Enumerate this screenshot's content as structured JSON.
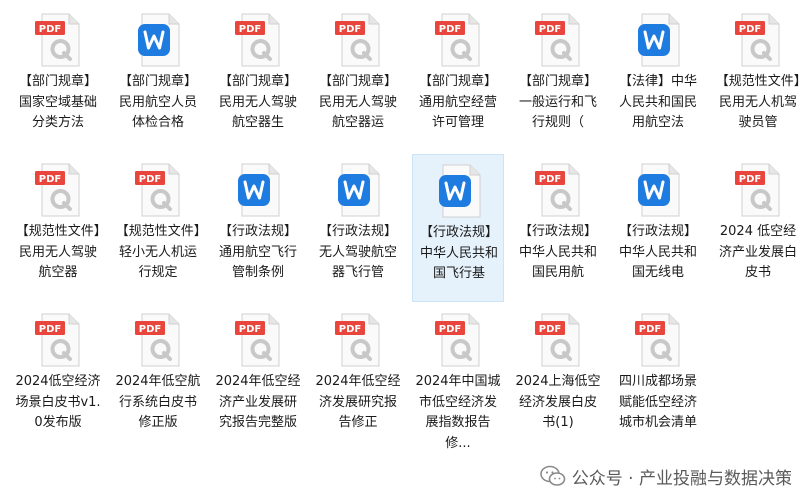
{
  "files": [
    {
      "type": "pdf",
      "name": "【部门规章】国家空域基础分类方法"
    },
    {
      "type": "word",
      "name": "【部门规章】民用航空人员体检合格"
    },
    {
      "type": "pdf",
      "name": "【部门规章】民用无人驾驶航空器生"
    },
    {
      "type": "pdf",
      "name": "【部门规章】民用无人驾驶航空器运"
    },
    {
      "type": "pdf",
      "name": "【部门规章】通用航空经营许可管理"
    },
    {
      "type": "pdf",
      "name": "【部门规章】一般运行和飞行规则（"
    },
    {
      "type": "word",
      "name": "【法律】中华人民共和国民用航空法"
    },
    {
      "type": "pdf",
      "name": "【规范性文件】民用无人机驾驶员管"
    },
    {
      "type": "pdf",
      "name": "【规范性文件】民用无人驾驶航空器"
    },
    {
      "type": "pdf",
      "name": "【规范性文件】轻小无人机运行规定"
    },
    {
      "type": "word",
      "name": "【行政法规】通用航空飞行管制条例"
    },
    {
      "type": "word",
      "name": "【行政法规】无人驾驶航空器飞行管"
    },
    {
      "type": "word",
      "name": "【行政法规】中华人民共和国飞行基",
      "selected": true
    },
    {
      "type": "pdf",
      "name": "【行政法规】中华人民共和国民用航"
    },
    {
      "type": "word",
      "name": "【行政法规】中华人民共和国无线电"
    },
    {
      "type": "pdf",
      "name": "2024 低空经济产业发展白皮书"
    },
    {
      "type": "pdf",
      "name": "2024低空经济场景白皮书v1.0发布版"
    },
    {
      "type": "pdf",
      "name": "2024年低空航行系统白皮书修正版"
    },
    {
      "type": "pdf",
      "name": "2024年低空经济产业发展研究报告完整版"
    },
    {
      "type": "pdf",
      "name": "2024年低空经济发展研究报告修正"
    },
    {
      "type": "pdf",
      "name": "2024年中国城市低空经济发展指数报告修..."
    },
    {
      "type": "pdf",
      "name": "2024上海低空经济发展白皮书(1)"
    },
    {
      "type": "pdf",
      "name": "四川成都场景赋能低空经济城市机会清单"
    }
  ],
  "icons": {
    "pdf": "pdf-file-icon",
    "word": "word-file-icon",
    "watermark": "wechat-icon"
  },
  "colors": {
    "pdf_badge": "#e8463c",
    "pdf_q": "#c8c8c8",
    "word_blue": "#1e7be0",
    "selected_bg": "#e5f1fb"
  },
  "watermark": {
    "text": "公众号 · 产业投融与数据决策"
  }
}
